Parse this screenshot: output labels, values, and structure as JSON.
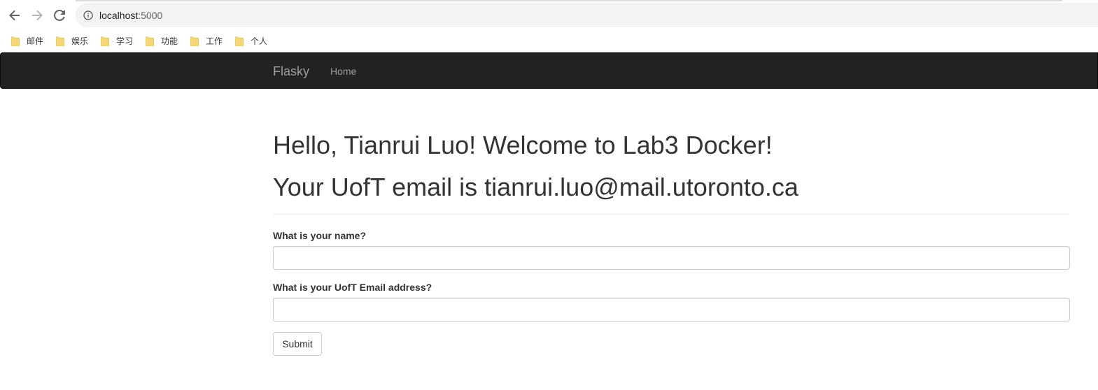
{
  "browser": {
    "url_host": "localhost",
    "url_port": ":5000",
    "bookmarks": [
      "邮件",
      "娱乐",
      "学习",
      "功能",
      "工作",
      "个人"
    ],
    "icons": [
      "back-arrow-icon",
      "forward-arrow-icon",
      "reload-icon",
      "info-icon",
      "folder-icon"
    ]
  },
  "navbar": {
    "brand": "Flasky",
    "links": [
      "Home"
    ],
    "background_color": "#222222",
    "link_color": "#9d9d9d"
  },
  "main": {
    "greeting": "Hello, Tianrui Luo! Welcome to Lab3 Docker!",
    "email_line": "Your UofT email is tianrui.luo@mail.utoronto.ca",
    "form": {
      "name_label": "What is your name?",
      "name_value": "",
      "email_label": "What is your UofT Email address?",
      "email_value": "",
      "submit_label": "Submit"
    }
  }
}
